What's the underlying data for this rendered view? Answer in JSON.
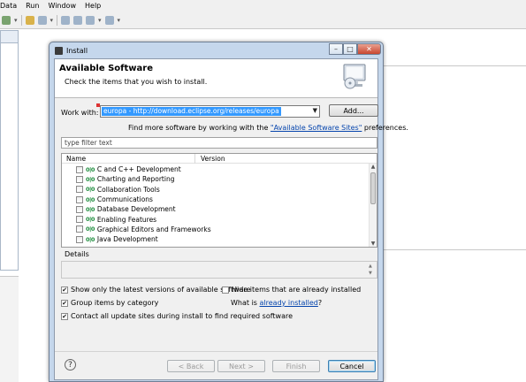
{
  "menubar": {
    "items": [
      "Data",
      "Run",
      "Window",
      "Help"
    ]
  },
  "dialog": {
    "title": "Install",
    "controls": {
      "minimize": "–",
      "maximize": "□",
      "close": "✕"
    },
    "header": {
      "title": "Available Software",
      "subtitle": "Check the items that you wish to install."
    },
    "work_with_label": "Work with:",
    "work_with_value": "europa - http://download.eclipse.org/releases/europa",
    "add_label": "Add...",
    "find_more_prefix": "Find more software by working with the",
    "find_more_link": "\"Available Software Sites\"",
    "find_more_suffix": "preferences.",
    "filter_placeholder": "type filter text",
    "columns": {
      "name": "Name",
      "version": "Version"
    },
    "items": [
      {
        "name": "C and C++ Development"
      },
      {
        "name": "Charting and Reporting"
      },
      {
        "name": "Collaboration Tools"
      },
      {
        "name": "Communications"
      },
      {
        "name": "Database Development"
      },
      {
        "name": "Enabling Features"
      },
      {
        "name": "Graphical Editors and Frameworks"
      },
      {
        "name": "Java Development"
      }
    ],
    "pkg_glyph": "0|0",
    "details_label": "Details",
    "options": {
      "latest_only": {
        "label": "Show only the latest versions of available software",
        "checked": true
      },
      "hide_installed": {
        "label": "Hide items that are already installed",
        "checked": false
      },
      "group_by_category": {
        "label": "Group items by category",
        "checked": true
      },
      "what_is_prefix": "What is",
      "already_installed_link": "already installed",
      "what_is_suffix": "?",
      "contact_update_sites": {
        "label": "Contact all update sites during install to find required software",
        "checked": true
      }
    },
    "buttons": {
      "help": "?",
      "back": "< Back",
      "next": "Next >",
      "finish": "Finish",
      "cancel": "Cancel"
    }
  },
  "colors": {
    "selection": "#3399ff",
    "link": "#0645ad",
    "dialog_frame": "#c5d7ec"
  }
}
